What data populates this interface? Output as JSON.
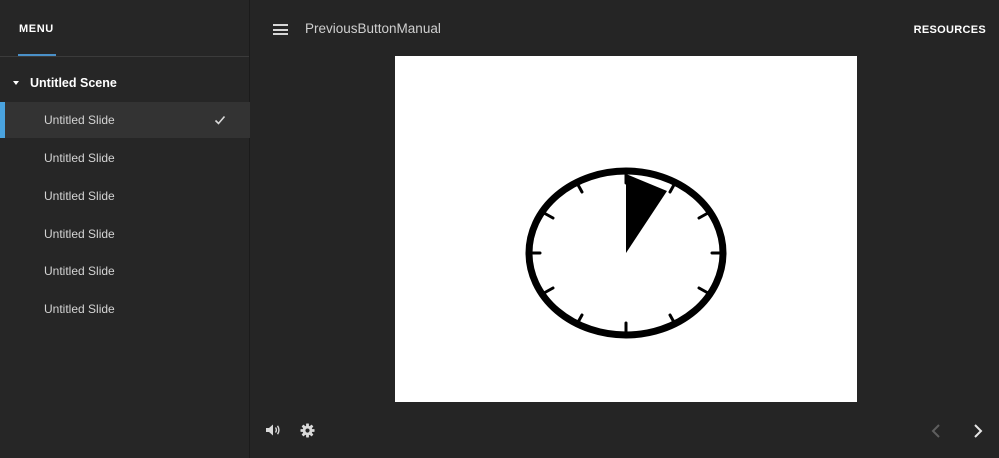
{
  "sidebar": {
    "menu_tab_label": "MENU",
    "scene": {
      "title": "Untitled Scene"
    },
    "slides": [
      {
        "label": "Untitled Slide",
        "active": true
      },
      {
        "label": "Untitled Slide",
        "active": false
      },
      {
        "label": "Untitled Slide",
        "active": false
      },
      {
        "label": "Untitled Slide",
        "active": false
      },
      {
        "label": "Untitled Slide",
        "active": false
      },
      {
        "label": "Untitled Slide",
        "active": false
      }
    ]
  },
  "topbar": {
    "course_title": "PreviousButtonManual",
    "resources_label": "RESOURCES"
  },
  "icons": {
    "hamburger": "hamburger-icon",
    "check": "check-icon",
    "volume": "volume-icon",
    "settings": "gear-icon",
    "prev": "chevron-left-icon",
    "next": "chevron-right-icon"
  },
  "colors": {
    "accent": "#4aa3df",
    "background": "#252525",
    "sidebar_active": "#333333"
  }
}
